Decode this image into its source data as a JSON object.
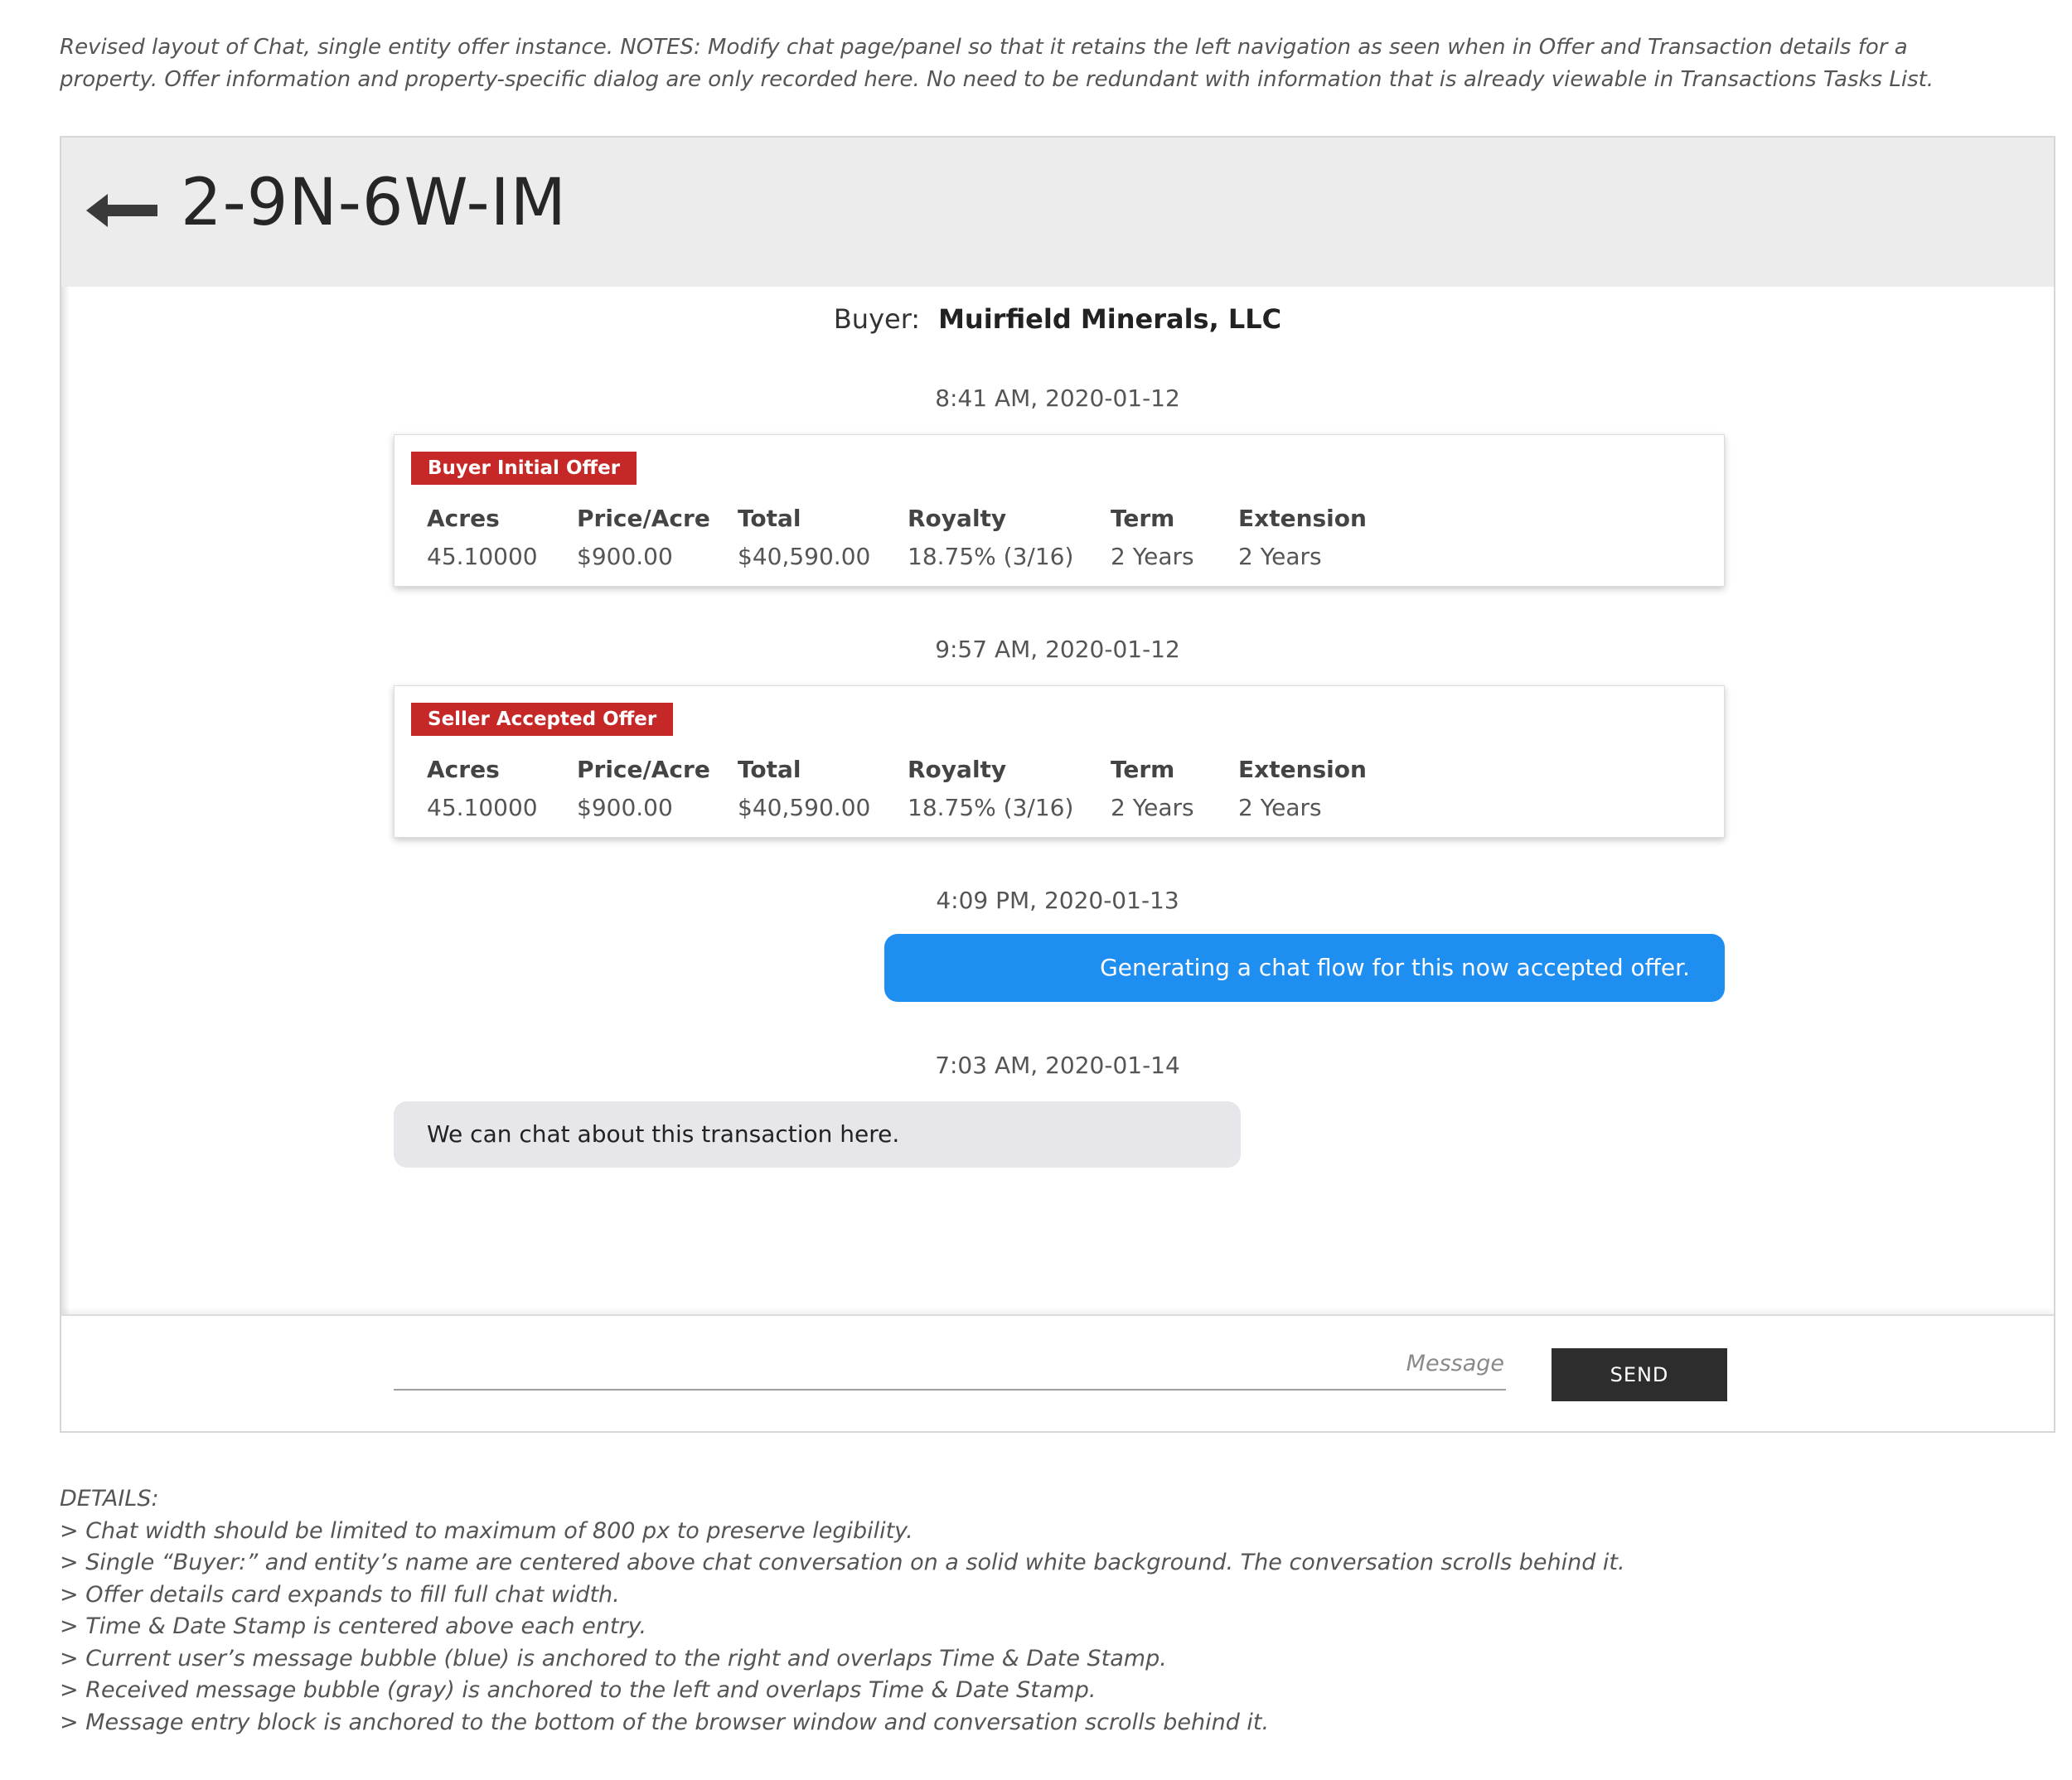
{
  "top_note": "Revised layout of Chat, single entity offer instance. NOTES: Modify chat page/panel so that it retains the left navigation as seen when in Offer and Transaction details for a property. Offer information and property-specific dialog are only recorded here. No need to be redundant with information that is already viewable in Transactions Tasks List.",
  "header": {
    "back_icon": "left-arrow-icon",
    "title": "2-9N-6W-IM"
  },
  "buyer": {
    "label": "Buyer:",
    "name": "Muirfield Minerals, LLC"
  },
  "conversation": {
    "offer_cards": [
      {
        "timestamp": "8:41 AM, 2020-01-12",
        "badge": "Buyer Initial Offer",
        "columns": [
          {
            "header": "Acres",
            "value": "45.10000"
          },
          {
            "header": "Price/Acre",
            "value": "$900.00"
          },
          {
            "header": "Total",
            "value": "$40,590.00"
          },
          {
            "header": "Royalty",
            "value": "18.75% (3/16)"
          },
          {
            "header": "Term",
            "value": "2 Years"
          },
          {
            "header": "Extension",
            "value": "2 Years"
          }
        ]
      },
      {
        "timestamp": "9:57 AM, 2020-01-12",
        "badge": "Seller Accepted Offer",
        "columns": [
          {
            "header": "Acres",
            "value": "45.10000"
          },
          {
            "header": "Price/Acre",
            "value": "$900.00"
          },
          {
            "header": "Total",
            "value": "$40,590.00"
          },
          {
            "header": "Royalty",
            "value": "18.75% (3/16)"
          },
          {
            "header": "Term",
            "value": "2 Years"
          },
          {
            "header": "Extension",
            "value": "2 Years"
          }
        ]
      }
    ],
    "sent_message": {
      "timestamp": "4:09 PM, 2020-01-13",
      "text": "Generating a chat flow for this now accepted offer."
    },
    "received_message": {
      "timestamp": "7:03 AM, 2020-01-14",
      "text": "We can chat about this transaction here."
    }
  },
  "message_entry": {
    "placeholder": "Message",
    "value": "",
    "send_label": "SEND"
  },
  "details": {
    "title": "DETAILS:",
    "lines": [
      "> Chat width should be limited to maximum of 800 px to preserve legibility.",
      "> Single “Buyer:” and entity’s name are centered above chat conversation on a solid white background. The conversation scrolls behind it.",
      "> Offer details card expands to fill full chat width.",
      "> Time & Date Stamp is centered above each entry.",
      "> Current user’s message bubble (blue) is anchored to the right and overlaps Time & Date Stamp.",
      "> Received message bubble (gray) is anchored to the left and overlaps Time & Date Stamp.",
      "> Message entry block is anchored to the bottom of the browser window and conversation scrolls behind it."
    ]
  },
  "colors": {
    "header_bg": "#ececec",
    "badge_red": "#c62828",
    "sent_bubble_blue": "#1f8ef1",
    "received_bubble_gray": "#e6e6eb",
    "send_button_bg": "#2d2d2d"
  }
}
